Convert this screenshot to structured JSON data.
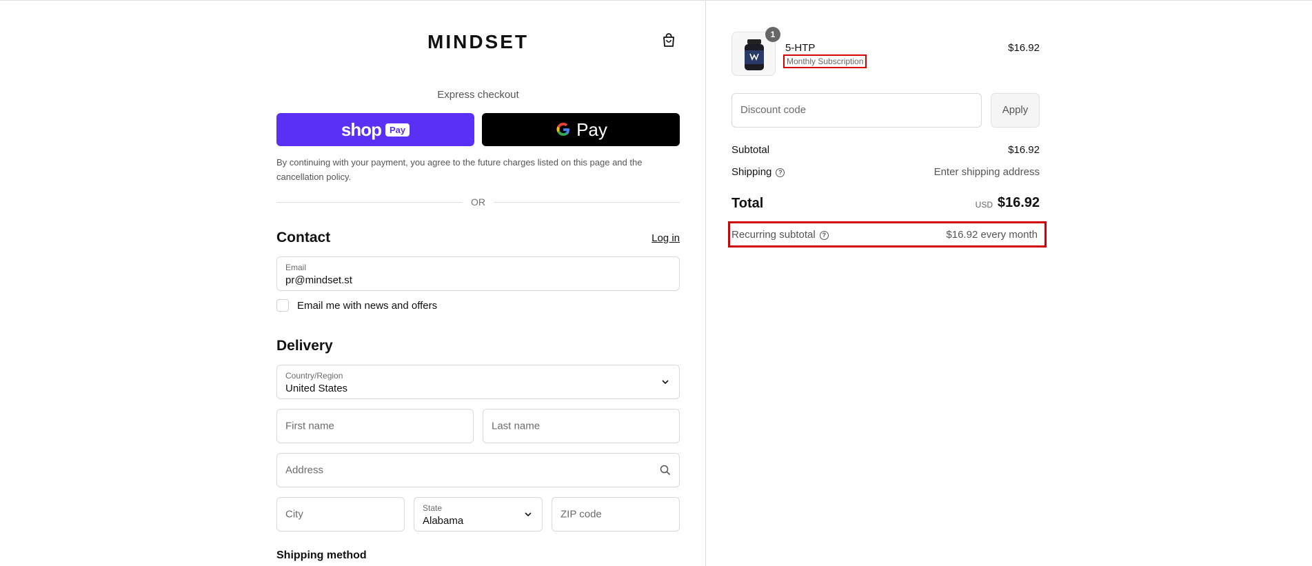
{
  "brand": {
    "name": "MINDSET"
  },
  "express": {
    "title": "Express checkout",
    "shop_pay_word": "shop",
    "shop_pay_pill": "Pay",
    "gpay_g": "G",
    "gpay_word": "Pay",
    "legal": "By continuing with your payment, you agree to the future charges listed on this page and the cancellation policy.",
    "or": "OR"
  },
  "contact": {
    "heading": "Contact",
    "login": "Log in",
    "email_label": "Email",
    "email_value": "pr@mindset.st",
    "newsletter_label": "Email me with news and offers"
  },
  "delivery": {
    "heading": "Delivery",
    "country_label": "Country/Region",
    "country_value": "United States",
    "first_name_ph": "First name",
    "last_name_ph": "Last name",
    "address_ph": "Address",
    "city_ph": "City",
    "state_label": "State",
    "state_value": "Alabama",
    "zip_ph": "ZIP code"
  },
  "shipping_method": {
    "heading": "Shipping method"
  },
  "summary": {
    "item": {
      "quantity": "1",
      "name": "5-HTP",
      "subtitle": "Monthly Subscription",
      "price": "$16.92"
    },
    "discount_ph": "Discount code",
    "apply_label": "Apply",
    "subtotal_label": "Subtotal",
    "subtotal_value": "$16.92",
    "shipping_label": "Shipping",
    "shipping_value": "Enter shipping address",
    "total_label": "Total",
    "total_currency": "USD",
    "total_value": "$16.92",
    "recurring_label": "Recurring subtotal",
    "recurring_value": "$16.92 every month"
  },
  "colors": {
    "shop_pay": "#5a31f4",
    "gpay": "#000000",
    "highlight": "#d40000"
  }
}
